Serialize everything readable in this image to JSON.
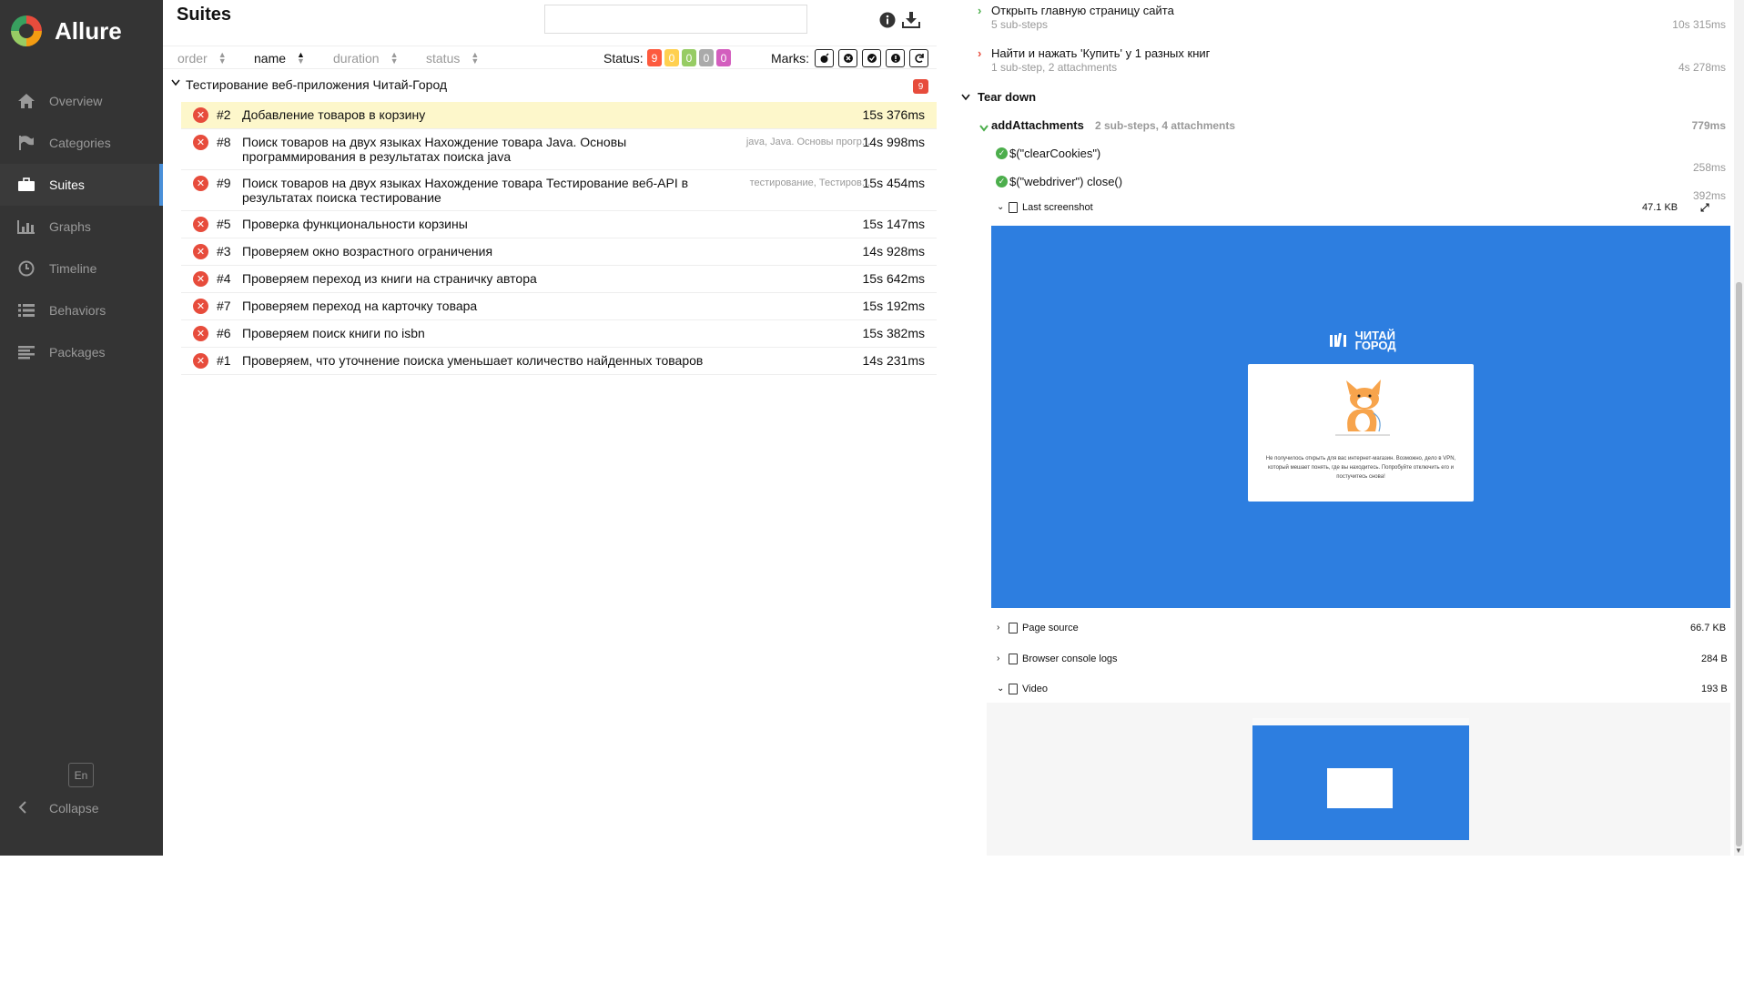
{
  "sidebar": {
    "brand": "Allure",
    "items": [
      {
        "label": "Overview",
        "icon": "home-icon"
      },
      {
        "label": "Categories",
        "icon": "flag-icon"
      },
      {
        "label": "Suites",
        "icon": "briefcase-icon"
      },
      {
        "label": "Graphs",
        "icon": "bar-chart-icon"
      },
      {
        "label": "Timeline",
        "icon": "clock-icon"
      },
      {
        "label": "Behaviors",
        "icon": "list-icon"
      },
      {
        "label": "Packages",
        "icon": "align-left-icon"
      }
    ],
    "active": "Suites",
    "lang": "En",
    "collapse": "Collapse"
  },
  "suites": {
    "title": "Suites",
    "search_value": "",
    "sort": {
      "order": "order",
      "name": "name",
      "duration": "duration",
      "status": "status"
    },
    "status_label": "Status:",
    "status_counts": [
      {
        "value": "9",
        "color": "#fd5a3e"
      },
      {
        "value": "0",
        "color": "#ffd050"
      },
      {
        "value": "0",
        "color": "#97cc64"
      },
      {
        "value": "0",
        "color": "#aaaaaa"
      },
      {
        "value": "0",
        "color": "#d35ebe"
      }
    ],
    "marks_label": "Marks:",
    "group": {
      "name": "Тестирование веб-приложения Читай-Город",
      "count": "9"
    },
    "tests": [
      {
        "num": "#2",
        "name": "Добавление товаров в корзину",
        "tags": "",
        "duration": "15s 376ms",
        "selected": true
      },
      {
        "num": "#8",
        "name": "Поиск товаров на двух языках Нахождение товара Java. Основы программирования в результатах поиска java",
        "tags": "java, Java. Основы прогр...",
        "duration": "14s 998ms",
        "selected": false
      },
      {
        "num": "#9",
        "name": "Поиск товаров на двух языках Нахождение товара Тестирование веб-API в результатах поиска тестирование",
        "tags": "тестирование, Тестиров...",
        "duration": "15s 454ms",
        "selected": false
      },
      {
        "num": "#5",
        "name": "Проверка функциональности корзины",
        "tags": "",
        "duration": "15s 147ms",
        "selected": false
      },
      {
        "num": "#3",
        "name": "Проверяем окно возрастного ограничения",
        "tags": "",
        "duration": "14s 928ms",
        "selected": false
      },
      {
        "num": "#4",
        "name": "Проверяем переход из книги на страничку автора",
        "tags": "",
        "duration": "15s 642ms",
        "selected": false
      },
      {
        "num": "#7",
        "name": "Проверяем переход на карточку товара",
        "tags": "",
        "duration": "15s 192ms",
        "selected": false
      },
      {
        "num": "#6",
        "name": "Проверяем поиск книги по isbn",
        "tags": "",
        "duration": "15s 382ms",
        "selected": false
      },
      {
        "num": "#1",
        "name": "Проверяем, что уточнение поиска уменьшает количество найденных товаров",
        "tags": "",
        "duration": "14s 231ms",
        "selected": false
      }
    ]
  },
  "detail": {
    "step1": {
      "title": "Открыть главную страницу сайта",
      "sub": "5 sub-steps",
      "time": "10s 315ms"
    },
    "step2": {
      "title": "Найти и нажать 'Купить' у 1 разных книг",
      "sub": "1 sub-step, 2 attachments",
      "time": "4s 278ms"
    },
    "teardown": "Tear down",
    "fixture": {
      "name": "addAttachments",
      "meta": "2 sub-steps, 4 attachments",
      "time": "779ms"
    },
    "substeps": [
      {
        "title": "$(\"clearCookies\")",
        "time": "258ms"
      },
      {
        "title": "$(\"webdriver\") close()",
        "time": "392ms"
      }
    ],
    "attachments": [
      {
        "name": "Last screenshot",
        "size": "47.1 KB"
      },
      {
        "name": "Page source",
        "size": "66.7 KB"
      },
      {
        "name": "Browser console logs",
        "size": "284 B"
      },
      {
        "name": "Video",
        "size": "193 B"
      }
    ],
    "screenshot_brand": "ЧИТАЙ ГОРОД",
    "screenshot_msg": "Не получилось открыть для вас интернет-магазин. Возможно, дело в VPN, который мешает понять, где вы находитесь. Попробуйте отключить его и постучитесь снова!"
  }
}
